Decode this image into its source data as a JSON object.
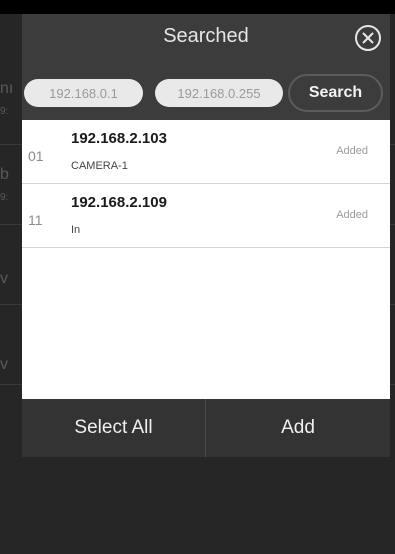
{
  "background": {
    "peek_fragments": [
      "nı",
      "9:",
      "b",
      "9:",
      "v",
      "v"
    ]
  },
  "dialog": {
    "title": "Searched",
    "close_icon": "circle-x-icon",
    "search": {
      "ip_start": "192.168.0.1",
      "ip_end": "192.168.0.255",
      "button_label": "Search"
    },
    "results": [
      {
        "index": "01",
        "ip": "192.168.2.103",
        "name": "CAMERA-1",
        "status": "Added"
      },
      {
        "index": "11",
        "ip": "192.168.2.109",
        "name": "In",
        "status": "Added"
      }
    ],
    "footer": {
      "select_all_label": "Select All",
      "add_label": "Add"
    }
  },
  "colors": {
    "backdrop": "#1e1e1e",
    "dialog_bg": "#3c3c3c",
    "list_bg": "#ffffff",
    "footer_bg": "#333333"
  }
}
